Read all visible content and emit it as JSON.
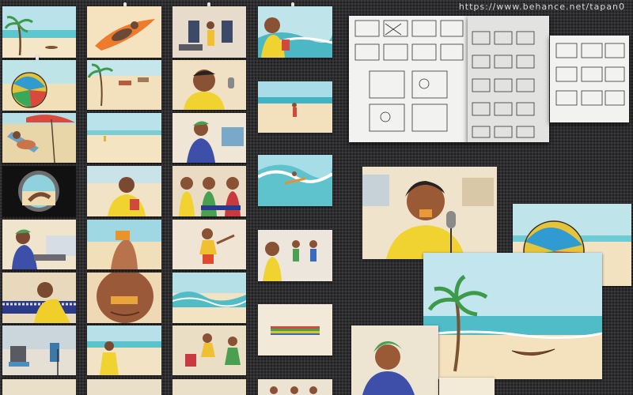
{
  "watermark": "https://www.behance.net/tapan0"
}
